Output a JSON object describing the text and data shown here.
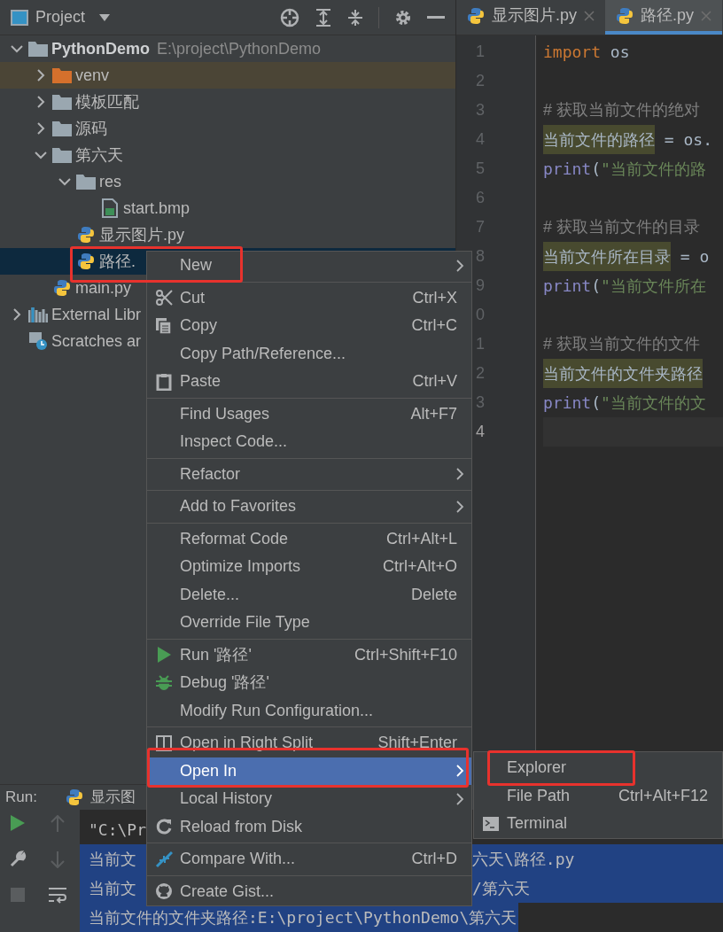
{
  "project_panel": {
    "title": "Project"
  },
  "tree": [
    {
      "label": "PythonDemo",
      "path": "E:\\project\\PythonDemo",
      "kind": "folder",
      "expanded": true,
      "selected": false,
      "children": [
        {
          "label": "venv",
          "kind": "excluded-folder",
          "expanded": false,
          "selected": false
        },
        {
          "label": "模板匹配",
          "kind": "folder",
          "expanded": false,
          "selected": false
        },
        {
          "label": "源码",
          "kind": "folder",
          "expanded": false,
          "selected": false
        },
        {
          "label": "第六天",
          "kind": "folder",
          "expanded": true,
          "selected": false,
          "children": [
            {
              "label": "res",
              "kind": "folder",
              "expanded": true,
              "selected": false,
              "children": [
                {
                  "label": "start.bmp",
                  "kind": "image",
                  "selected": false
                }
              ]
            },
            {
              "label": "显示图片.py",
              "kind": "python",
              "selected": false
            },
            {
              "label": "路径.",
              "kind": "python",
              "selected": true,
              "marked": true
            }
          ]
        },
        {
          "label": "main.py",
          "kind": "python",
          "selected": false
        }
      ]
    },
    {
      "label": "External Libr",
      "kind": "library",
      "expanded": false,
      "selected": false
    },
    {
      "label": "Scratches ar",
      "kind": "scratches",
      "selected": false
    }
  ],
  "tabs": [
    {
      "label": "显示图片.py",
      "selected": false
    },
    {
      "label": "路径.py",
      "selected": true
    }
  ],
  "editor": {
    "lines": [
      {
        "number": "1",
        "current": false,
        "tokens": [
          {
            "kind": "keyword",
            "text": "import"
          },
          {
            "kind": "plain",
            "text": " os"
          }
        ]
      },
      {
        "number": "2",
        "current": false
      },
      {
        "number": "3",
        "current": false,
        "tokens": [
          {
            "kind": "comment",
            "text": "# 获取当前文件的绝对"
          }
        ]
      },
      {
        "number": "4",
        "current": false,
        "tokens": [
          {
            "kind": "var",
            "text": "当前文件的路径"
          },
          {
            "kind": "plain",
            "text": " = os."
          }
        ]
      },
      {
        "number": "5",
        "current": false,
        "tokens": [
          {
            "kind": "builtin",
            "text": "print"
          },
          {
            "kind": "plain",
            "text": "("
          },
          {
            "kind": "string",
            "text": "\"当前文件的路"
          }
        ]
      },
      {
        "number": "6",
        "current": false
      },
      {
        "number": "7",
        "current": false,
        "tokens": [
          {
            "kind": "comment",
            "text": "# 获取当前文件的目录"
          }
        ]
      },
      {
        "number": "8",
        "current": false,
        "tokens": [
          {
            "kind": "var",
            "text": "当前文件所在目录"
          },
          {
            "kind": "plain",
            "text": " = o"
          }
        ]
      },
      {
        "number": "9",
        "current": false,
        "tokens": [
          {
            "kind": "builtin",
            "text": "print"
          },
          {
            "kind": "plain",
            "text": "("
          },
          {
            "kind": "string",
            "text": "\"当前文件所在"
          }
        ]
      },
      {
        "number": "0",
        "current": false
      },
      {
        "number": "1",
        "current": false,
        "tokens": [
          {
            "kind": "comment",
            "text": "# 获取当前文件的文件"
          }
        ]
      },
      {
        "number": "2",
        "current": false,
        "tokens": [
          {
            "kind": "var",
            "text": "当前文件的文件夹路径"
          }
        ]
      },
      {
        "number": "3",
        "current": false,
        "tokens": [
          {
            "kind": "builtin",
            "text": "print"
          },
          {
            "kind": "plain",
            "text": "("
          },
          {
            "kind": "string",
            "text": "\"当前文件的文"
          }
        ]
      },
      {
        "number": "4",
        "current": true
      }
    ]
  },
  "run_panel": {
    "label": "Run:",
    "tab": "显示图",
    "console": [
      {
        "text": "\"C:\\Pr",
        "selected": false
      },
      {
        "text": "当前文",
        "right": "六天\\路径.py",
        "selected": true
      },
      {
        "text": "当前文",
        "right": "/第六天",
        "selected": true
      },
      {
        "text": "当前文件的文件夹路径:E:\\project\\PythonDemo\\第六天",
        "selected": true
      }
    ]
  },
  "context_menu": {
    "items": [
      {
        "kind": "new",
        "label": "New",
        "submenu": true,
        "selected": false,
        "marked": true
      },
      {
        "kind": "separator"
      },
      {
        "kind": "cut",
        "label": "Cut",
        "shortcut": "Ctrl+X",
        "selected": false
      },
      {
        "kind": "copy",
        "label": "Copy",
        "shortcut": "Ctrl+C",
        "selected": false
      },
      {
        "kind": "plain",
        "label": "Copy Path/Reference...",
        "selected": false
      },
      {
        "kind": "paste",
        "label": "Paste",
        "shortcut": "Ctrl+V",
        "selected": false
      },
      {
        "kind": "separator"
      },
      {
        "kind": "plain",
        "label": "Find Usages",
        "shortcut": "Alt+F7",
        "selected": false
      },
      {
        "kind": "plain",
        "label": "Inspect Code...",
        "selected": false
      },
      {
        "kind": "separator"
      },
      {
        "kind": "plain",
        "label": "Refactor",
        "submenu": true,
        "selected": false
      },
      {
        "kind": "separator"
      },
      {
        "kind": "plain",
        "label": "Add to Favorites",
        "submenu": true,
        "selected": false
      },
      {
        "kind": "separator"
      },
      {
        "kind": "plain",
        "label": "Reformat Code",
        "shortcut": "Ctrl+Alt+L",
        "selected": false
      },
      {
        "kind": "plain",
        "label": "Optimize Imports",
        "shortcut": "Ctrl+Alt+O",
        "selected": false
      },
      {
        "kind": "plain",
        "label": "Delete...",
        "shortcut": "Delete",
        "selected": false
      },
      {
        "kind": "plain",
        "label": "Override File Type",
        "selected": false
      },
      {
        "kind": "separator"
      },
      {
        "kind": "run",
        "label": "Run '路径'",
        "shortcut": "Ctrl+Shift+F10",
        "selected": false
      },
      {
        "kind": "debug",
        "label": "Debug '路径'",
        "selected": false
      },
      {
        "kind": "plain",
        "label": "Modify Run Configuration...",
        "selected": false
      },
      {
        "kind": "separator"
      },
      {
        "kind": "split",
        "label": "Open in Right Split",
        "shortcut": "Shift+Enter",
        "selected": false
      },
      {
        "kind": "plain",
        "label": "Open In",
        "submenu": true,
        "selected": true,
        "marked": true
      },
      {
        "kind": "plain",
        "label": "Local History",
        "submenu": true,
        "selected": false
      },
      {
        "kind": "reload",
        "label": "Reload from Disk",
        "selected": false
      },
      {
        "kind": "separator"
      },
      {
        "kind": "compare",
        "label": "Compare With...",
        "shortcut": "Ctrl+D",
        "selected": false
      },
      {
        "kind": "separator"
      },
      {
        "kind": "gist",
        "label": "Create Gist...",
        "selected": false
      }
    ]
  },
  "submenu": {
    "items": [
      {
        "kind": "plain",
        "label": "Explorer",
        "selected": false,
        "marked": true
      },
      {
        "kind": "plain",
        "label": "File Path",
        "shortcut": "Ctrl+Alt+F12",
        "selected": false
      },
      {
        "kind": "terminal",
        "label": "Terminal",
        "selected": false
      }
    ]
  }
}
